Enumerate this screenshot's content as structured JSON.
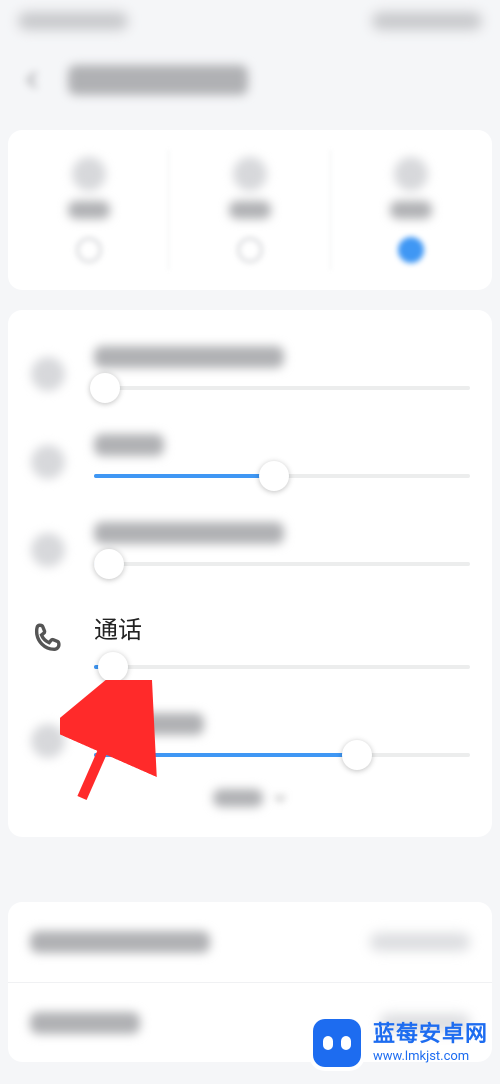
{
  "accent": "#3f97f4",
  "status": {
    "left_placeholder": "",
    "right_placeholder": ""
  },
  "header": {
    "title_placeholder": "声音和振动"
  },
  "modes": {
    "ring": {
      "label_placeholder": "响铃",
      "selected": false
    },
    "silent": {
      "label_placeholder": "静音",
      "selected": false
    },
    "dnd": {
      "label_placeholder": "勿扰",
      "selected": true
    }
  },
  "volumes": {
    "ringtone": {
      "label_placeholder": "来电、信息、通知",
      "value_pct": 3
    },
    "media": {
      "label_placeholder": "媒体",
      "value_pct": 48
    },
    "alarm": {
      "label_placeholder": "音乐、视频、游戏",
      "value_pct": 4
    },
    "call": {
      "label": "通话",
      "value_pct": 5
    },
    "assistant": {
      "label_placeholder": "语音助手",
      "value_pct": 70
    }
  },
  "more_label_placeholder": "更多",
  "bottom_list": {
    "row1": {
      "left_placeholder": "设置响铃与振动",
      "right_placeholder": "响铃且振 >"
    },
    "row2": {
      "left_placeholder": "来电铃声",
      "right_placeholder": "默认 >"
    }
  },
  "watermark": {
    "title": "蓝莓安卓网",
    "url": "www.lmkjst.com"
  }
}
